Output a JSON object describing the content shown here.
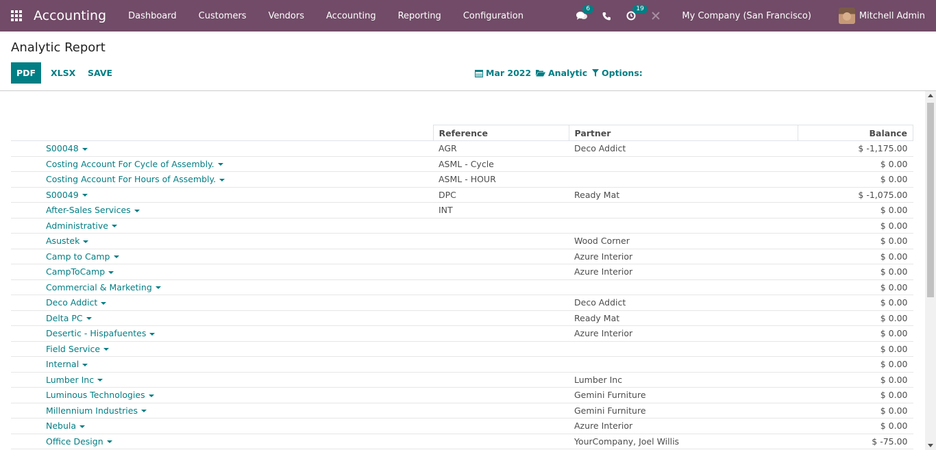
{
  "navbar": {
    "brand": "Accounting",
    "menu": [
      "Dashboard",
      "Customers",
      "Vendors",
      "Accounting",
      "Reporting",
      "Configuration"
    ],
    "messages_count": "6",
    "activities_count": "19",
    "company": "My Company (San Francisco)",
    "user": "Mitchell Admin"
  },
  "control_panel": {
    "title": "Analytic Report",
    "pdf": "PDF",
    "xlsx": "XLSX",
    "save": "SAVE",
    "date_filter": "Mar 2022",
    "analytic_filter": "Analytic",
    "options_filter": "Options:"
  },
  "table": {
    "headers": {
      "reference": "Reference",
      "partner": "Partner",
      "balance": "Balance"
    },
    "rows": [
      {
        "name": "S00048",
        "reference": "AGR",
        "partner": "Deco Addict",
        "balance": "$ -1,175.00"
      },
      {
        "name": "Costing Account For Cycle of Assembly.",
        "reference": "ASML - Cycle",
        "partner": "",
        "balance": "$ 0.00"
      },
      {
        "name": "Costing Account For Hours of Assembly.",
        "reference": "ASML - HOUR",
        "partner": "",
        "balance": "$ 0.00"
      },
      {
        "name": "S00049",
        "reference": "DPC",
        "partner": "Ready Mat",
        "balance": "$ -1,075.00"
      },
      {
        "name": "After-Sales Services",
        "reference": "INT",
        "partner": "",
        "balance": "$ 0.00"
      },
      {
        "name": "Administrative",
        "reference": "",
        "partner": "",
        "balance": "$ 0.00"
      },
      {
        "name": "Asustek",
        "reference": "",
        "partner": "Wood Corner",
        "balance": "$ 0.00"
      },
      {
        "name": "Camp to Camp",
        "reference": "",
        "partner": "Azure Interior",
        "balance": "$ 0.00"
      },
      {
        "name": "CampToCamp",
        "reference": "",
        "partner": "Azure Interior",
        "balance": "$ 0.00"
      },
      {
        "name": "Commercial & Marketing",
        "reference": "",
        "partner": "",
        "balance": "$ 0.00"
      },
      {
        "name": "Deco Addict",
        "reference": "",
        "partner": "Deco Addict",
        "balance": "$ 0.00"
      },
      {
        "name": "Delta PC",
        "reference": "",
        "partner": "Ready Mat",
        "balance": "$ 0.00"
      },
      {
        "name": "Desertic - Hispafuentes",
        "reference": "",
        "partner": "Azure Interior",
        "balance": "$ 0.00"
      },
      {
        "name": "Field Service",
        "reference": "",
        "partner": "",
        "balance": "$ 0.00"
      },
      {
        "name": "Internal",
        "reference": "",
        "partner": "",
        "balance": "$ 0.00"
      },
      {
        "name": "Lumber Inc",
        "reference": "",
        "partner": "Lumber Inc",
        "balance": "$ 0.00"
      },
      {
        "name": "Luminous Technologies",
        "reference": "",
        "partner": "Gemini Furniture",
        "balance": "$ 0.00"
      },
      {
        "name": "Millennium Industries",
        "reference": "",
        "partner": "Gemini Furniture",
        "balance": "$ 0.00"
      },
      {
        "name": "Nebula",
        "reference": "",
        "partner": "Azure Interior",
        "balance": "$ 0.00"
      },
      {
        "name": "Office Design",
        "reference": "",
        "partner": "YourCompany, Joel Willis",
        "balance": "$ -75.00"
      }
    ]
  }
}
